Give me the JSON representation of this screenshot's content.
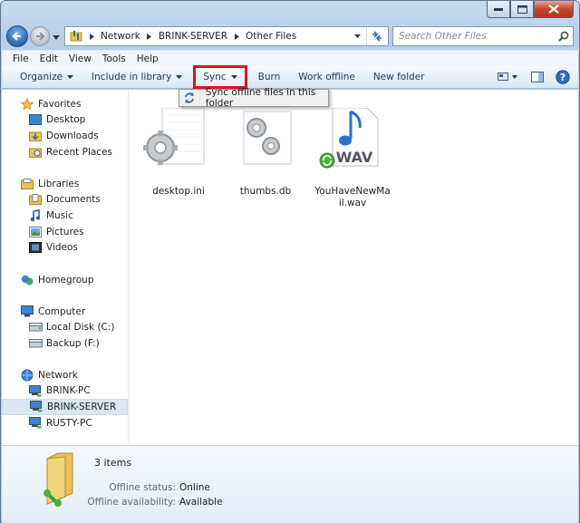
{
  "address": {
    "crumbs": [
      "Network",
      "BRINK-SERVER",
      "Other Files"
    ]
  },
  "search": {
    "placeholder": "Search Other Files"
  },
  "menubar": {
    "items": [
      "File",
      "Edit",
      "View",
      "Tools",
      "Help"
    ]
  },
  "toolbar": {
    "organize": "Organize",
    "include": "Include in library",
    "sync": "Sync",
    "burn": "Burn",
    "work_offline": "Work offline",
    "new_folder": "New folder"
  },
  "sync_menu": {
    "item": "Sync offline files in this folder"
  },
  "sidebar": {
    "favorites": {
      "label": "Favorites",
      "items": [
        "Desktop",
        "Downloads",
        "Recent Places"
      ]
    },
    "libraries": {
      "label": "Libraries",
      "items": [
        "Documents",
        "Music",
        "Pictures",
        "Videos"
      ]
    },
    "homegroup": {
      "label": "Homegroup"
    },
    "computer": {
      "label": "Computer",
      "items": [
        "Local Disk (C:)",
        "Backup (F:)"
      ]
    },
    "network": {
      "label": "Network",
      "items": [
        "BRINK-PC",
        "BRINK-SERVER",
        "RUSTY-PC"
      ]
    }
  },
  "files": [
    {
      "name": "desktop.ini",
      "type": "settings-file-icon"
    },
    {
      "name": "thumbs.db",
      "type": "settings-file-icon"
    },
    {
      "name": "YouHaveNewMail.wav",
      "type": "wav-audio-icon",
      "badge_text": "WAV"
    }
  ],
  "details": {
    "count": "3 items",
    "offline_status_label": "Offline status:",
    "offline_status_value": "Online",
    "offline_availability_label": "Offline availability:",
    "offline_availability_value": "Available"
  },
  "colors": {
    "highlight_border": "#e0141b",
    "toolbar_text": "#1e395b",
    "selected_bg": "#dbe6f4"
  }
}
